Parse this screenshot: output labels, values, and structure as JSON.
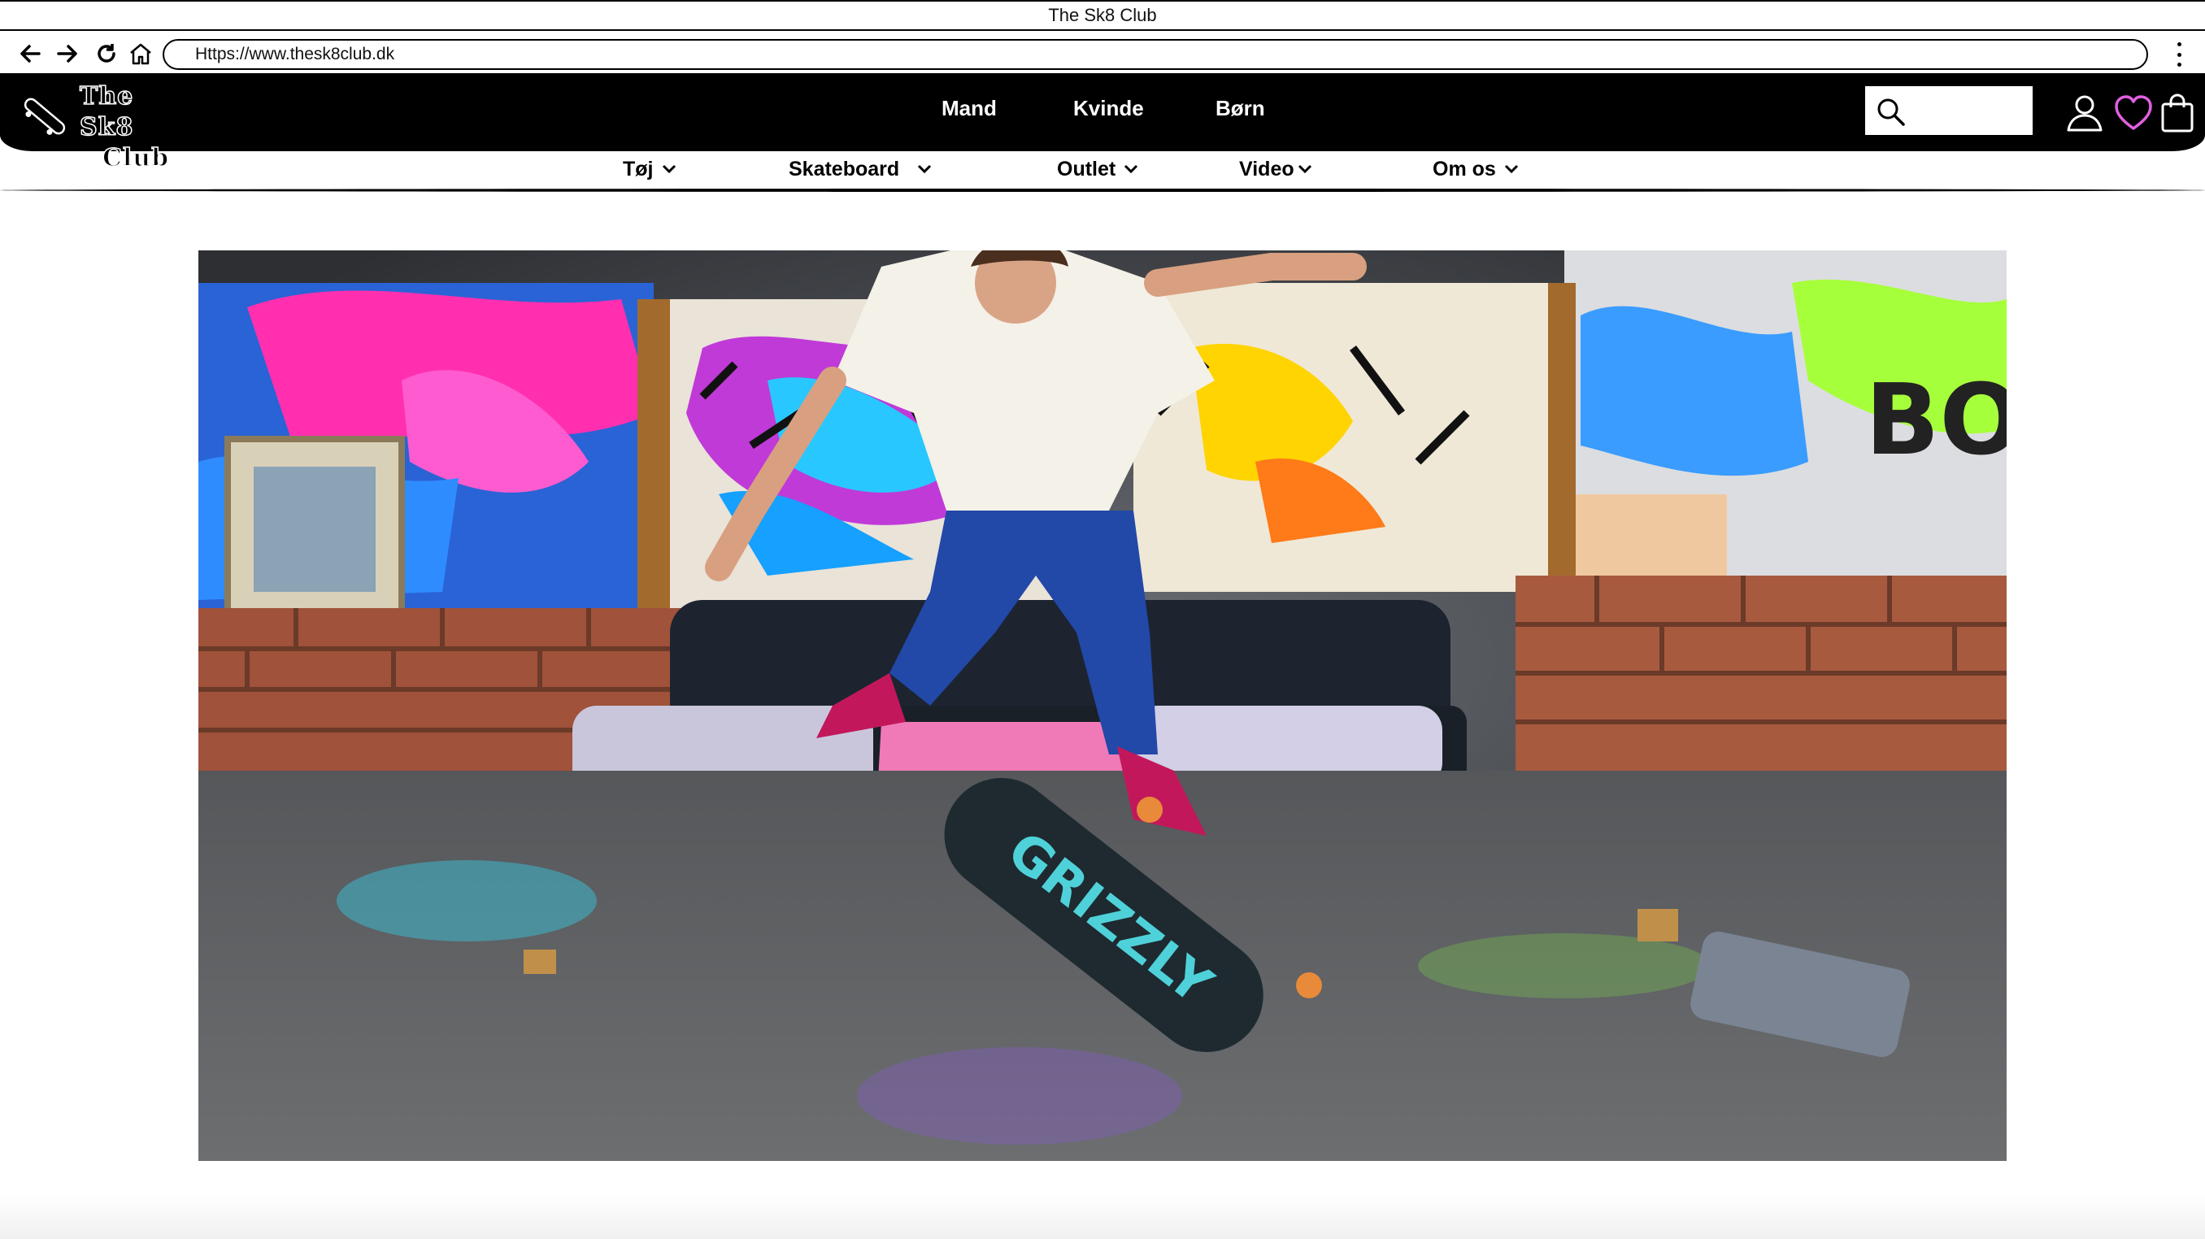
{
  "window": {
    "title": "The Sk8 Club"
  },
  "browser": {
    "url": "Https://www.thesk8club.dk",
    "icons": [
      "back-arrow-icon",
      "forward-arrow-icon",
      "reload-icon",
      "home-icon",
      "more-vertical-icon"
    ]
  },
  "header": {
    "logo": {
      "line1": "The Sk8",
      "line2": "Club",
      "icon": "skateboard-icon"
    },
    "nav": [
      {
        "label": "Mand"
      },
      {
        "label": "Kvinde"
      },
      {
        "label": "Børn"
      }
    ],
    "search": {
      "placeholder": "",
      "icon": "search-icon"
    },
    "icons": [
      "user-icon",
      "heart-icon",
      "shopping-bag-icon"
    ],
    "accent_color": "#e060e0"
  },
  "subnav": [
    {
      "label": "Tøj"
    },
    {
      "label": "Skateboard"
    },
    {
      "label": "Outlet"
    },
    {
      "label": "Video"
    },
    {
      "label": "Om os"
    }
  ],
  "hero": {
    "description_icon": "skater-kickflip-photo",
    "board_text": "GRIZZLY"
  }
}
